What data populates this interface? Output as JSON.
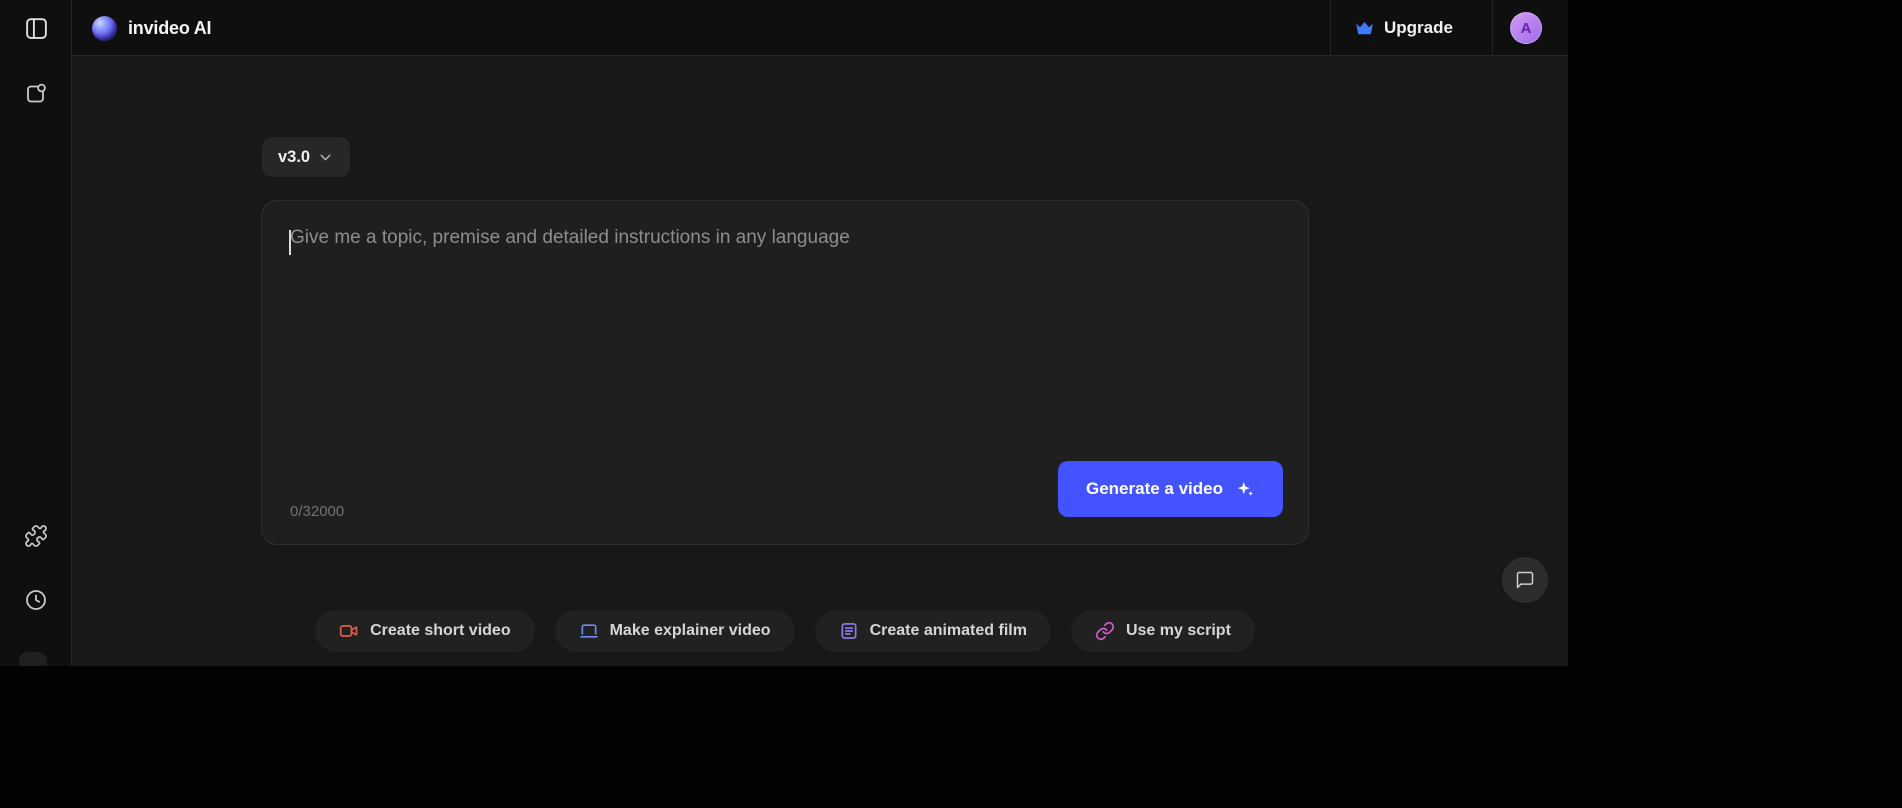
{
  "topbar": {
    "logo_text": "invideo AI",
    "upgrade_label": "Upgrade",
    "avatar_initial": "A"
  },
  "composer": {
    "version_label": "v3.0",
    "placeholder": "Give me a topic, premise and detailed instructions in any language",
    "char_counter": "0/32000",
    "generate_label": "Generate a video"
  },
  "suggestions": [
    {
      "label": "Create short video",
      "icon": "video-camera-icon",
      "icon_color": "#e05d4d"
    },
    {
      "label": "Make explainer video",
      "icon": "laptop-icon",
      "icon_color": "#6c8cf5"
    },
    {
      "label": "Create animated film",
      "icon": "script-lines-icon",
      "icon_color": "#8f7bf0"
    },
    {
      "label": "Use my script",
      "icon": "link-icon",
      "icon_color": "#d85bd3"
    }
  ],
  "colors": {
    "accent_blue": "#4353ff",
    "upgrade_crown": "#3d7bfd",
    "avatar_bg": "#b97ce8",
    "main_bg": "#181818",
    "bar_bg": "#0f0f0f"
  }
}
